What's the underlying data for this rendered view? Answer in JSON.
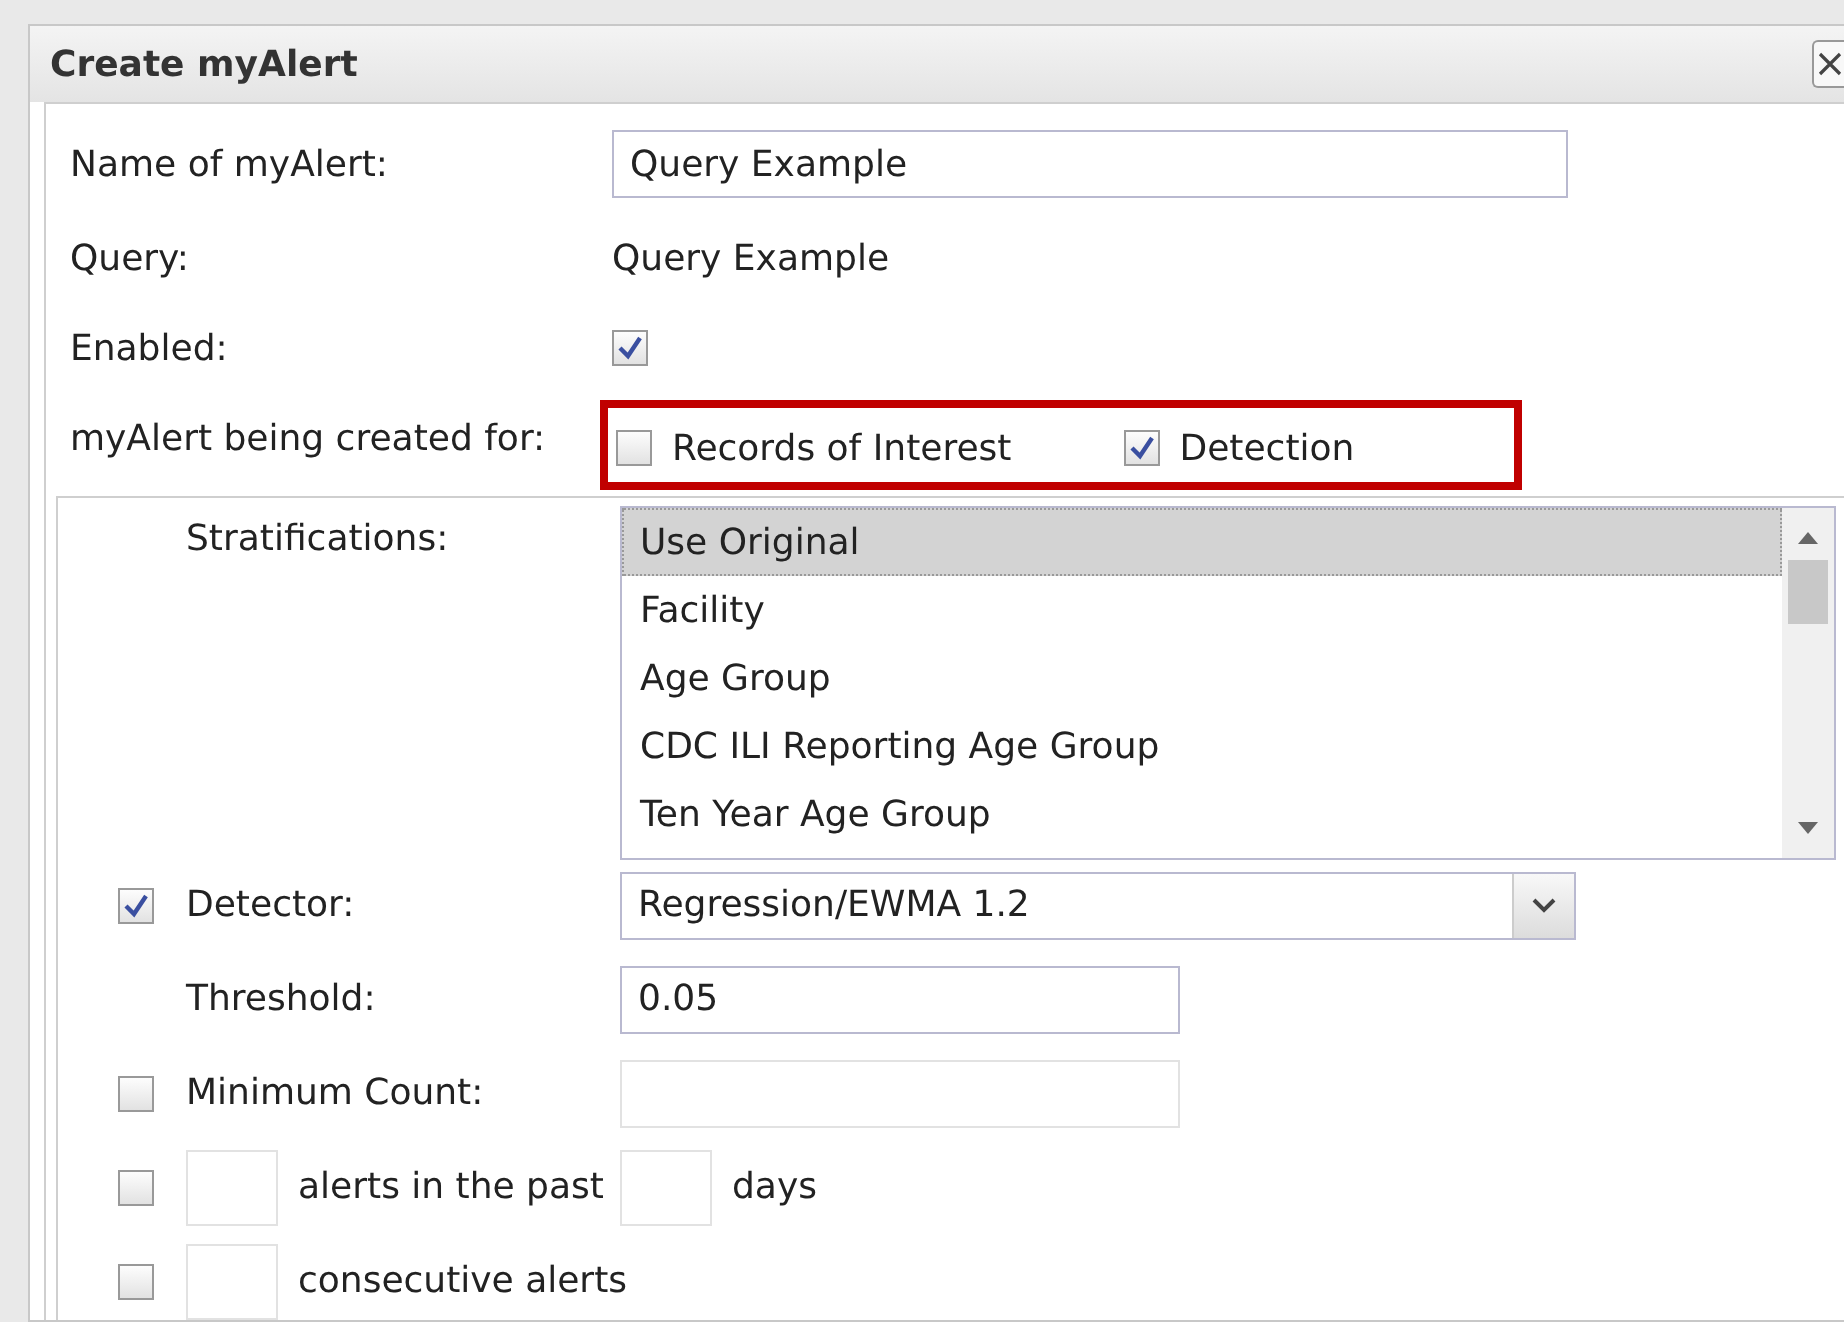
{
  "dialog": {
    "title": "Create myAlert"
  },
  "name_field": {
    "label": "Name of myAlert:",
    "value": "Query Example"
  },
  "query": {
    "label": "Query:",
    "value": "Query Example"
  },
  "enabled": {
    "label": "Enabled:",
    "checked": true
  },
  "created_for": {
    "label": "myAlert being created for:",
    "highlighted": true,
    "options": [
      {
        "label": "Records of Interest",
        "checked": false
      },
      {
        "label": "Detection",
        "checked": true
      }
    ]
  },
  "stratifications": {
    "label": "Stratifications:",
    "items": [
      {
        "label": "Use Original",
        "selected": true
      },
      {
        "label": "Facility",
        "selected": false
      },
      {
        "label": "Age Group",
        "selected": false
      },
      {
        "label": "CDC ILI Reporting Age Group",
        "selected": false
      },
      {
        "label": "Ten Year Age Group",
        "selected": false
      }
    ]
  },
  "detector": {
    "label": "Detector:",
    "checked": true,
    "value": "Regression/EWMA 1.2"
  },
  "threshold": {
    "label": "Threshold:",
    "value": "0.05"
  },
  "minimum_count": {
    "label": "Minimum Count:",
    "checked": false,
    "disabled": true
  },
  "alerts_in_past": {
    "checked": false,
    "text": "alerts in the past",
    "unit": "days"
  },
  "consecutive": {
    "checked": false,
    "text": "consecutive alerts"
  }
}
